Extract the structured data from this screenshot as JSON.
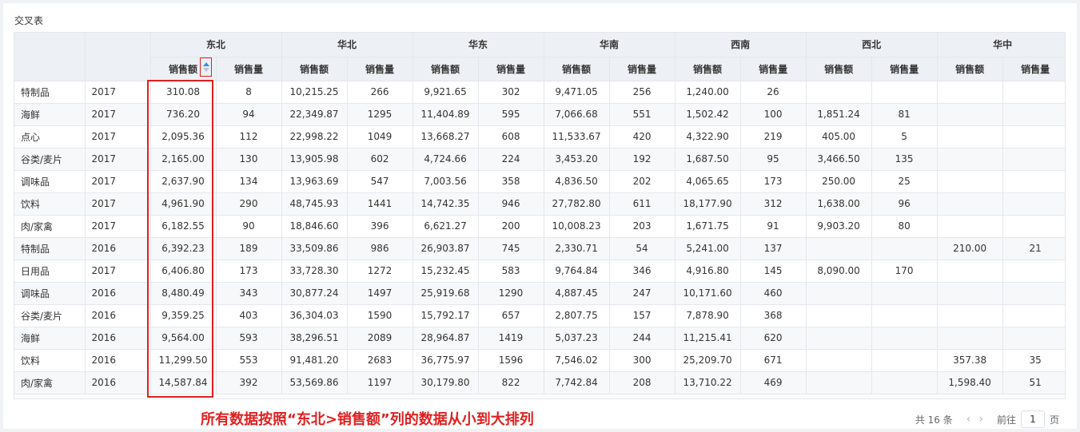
{
  "title": "交叉表",
  "regions": [
    "东北",
    "华北",
    "华东",
    "华南",
    "西南",
    "西北",
    "华中"
  ],
  "measures": [
    "销售额",
    "销售量"
  ],
  "rows": [
    {
      "cat": "特制品",
      "year": "2017",
      "v": [
        "310.08",
        "8",
        "10,215.25",
        "266",
        "9,921.65",
        "302",
        "9,471.05",
        "256",
        "1,240.00",
        "26",
        "",
        "",
        "",
        ""
      ]
    },
    {
      "cat": "海鲜",
      "year": "2017",
      "v": [
        "736.20",
        "94",
        "22,349.87",
        "1295",
        "11,404.89",
        "595",
        "7,066.68",
        "551",
        "1,502.42",
        "100",
        "1,851.24",
        "81",
        "",
        ""
      ]
    },
    {
      "cat": "点心",
      "year": "2017",
      "v": [
        "2,095.36",
        "112",
        "22,998.22",
        "1049",
        "13,668.27",
        "608",
        "11,533.67",
        "420",
        "4,322.90",
        "219",
        "405.00",
        "5",
        "",
        ""
      ]
    },
    {
      "cat": "谷类/麦片",
      "year": "2017",
      "v": [
        "2,165.00",
        "130",
        "13,905.98",
        "602",
        "4,724.66",
        "224",
        "3,453.20",
        "192",
        "1,687.50",
        "95",
        "3,466.50",
        "135",
        "",
        ""
      ]
    },
    {
      "cat": "调味品",
      "year": "2017",
      "v": [
        "2,637.90",
        "134",
        "13,963.69",
        "547",
        "7,003.56",
        "358",
        "4,836.50",
        "202",
        "4,065.65",
        "173",
        "250.00",
        "25",
        "",
        ""
      ]
    },
    {
      "cat": "饮料",
      "year": "2017",
      "v": [
        "4,961.90",
        "290",
        "48,745.93",
        "1441",
        "14,742.35",
        "946",
        "27,782.80",
        "611",
        "18,177.90",
        "312",
        "1,638.00",
        "96",
        "",
        ""
      ]
    },
    {
      "cat": "肉/家禽",
      "year": "2017",
      "v": [
        "6,182.55",
        "90",
        "18,846.60",
        "396",
        "6,621.27",
        "200",
        "10,008.23",
        "203",
        "1,671.75",
        "91",
        "9,903.20",
        "80",
        "",
        ""
      ]
    },
    {
      "cat": "特制品",
      "year": "2016",
      "v": [
        "6,392.23",
        "189",
        "33,509.86",
        "986",
        "26,903.87",
        "745",
        "2,330.71",
        "54",
        "5,241.00",
        "137",
        "",
        "",
        "210.00",
        "21"
      ]
    },
    {
      "cat": "日用品",
      "year": "2017",
      "v": [
        "6,406.80",
        "173",
        "33,728.30",
        "1272",
        "15,232.45",
        "583",
        "9,764.84",
        "346",
        "4,916.80",
        "145",
        "8,090.00",
        "170",
        "",
        ""
      ]
    },
    {
      "cat": "调味品",
      "year": "2016",
      "v": [
        "8,480.49",
        "343",
        "30,877.24",
        "1497",
        "25,919.68",
        "1290",
        "4,887.45",
        "247",
        "10,171.60",
        "460",
        "",
        "",
        "",
        ""
      ]
    },
    {
      "cat": "谷类/麦片",
      "year": "2016",
      "v": [
        "9,359.25",
        "403",
        "36,304.03",
        "1590",
        "15,792.17",
        "657",
        "2,807.75",
        "157",
        "7,878.90",
        "368",
        "",
        "",
        "",
        ""
      ]
    },
    {
      "cat": "海鲜",
      "year": "2016",
      "v": [
        "9,564.00",
        "593",
        "38,296.51",
        "2089",
        "28,964.87",
        "1419",
        "5,037.23",
        "244",
        "11,215.41",
        "620",
        "",
        "",
        "",
        ""
      ]
    },
    {
      "cat": "饮料",
      "year": "2016",
      "v": [
        "11,299.50",
        "553",
        "91,481.20",
        "2683",
        "36,775.97",
        "1596",
        "7,546.02",
        "300",
        "25,209.70",
        "671",
        "",
        "",
        "357.38",
        "35"
      ]
    },
    {
      "cat": "肉/家禽",
      "year": "2016",
      "v": [
        "14,587.84",
        "392",
        "53,569.86",
        "1197",
        "30,179.80",
        "822",
        "7,742.84",
        "208",
        "13,710.22",
        "469",
        "",
        "",
        "1,598.40",
        "51"
      ]
    }
  ],
  "annotation": "所有数据按照“东北>销售额”列的数据从小到大排列",
  "pager": {
    "total": "共 16 条",
    "prev": "‹",
    "next": "›",
    "goto": "前往",
    "page": "1",
    "unit": "页"
  },
  "colors": {
    "accent": "#e02020",
    "sort_active": "#3a8ee6",
    "header_bg": "#edf0f4"
  }
}
